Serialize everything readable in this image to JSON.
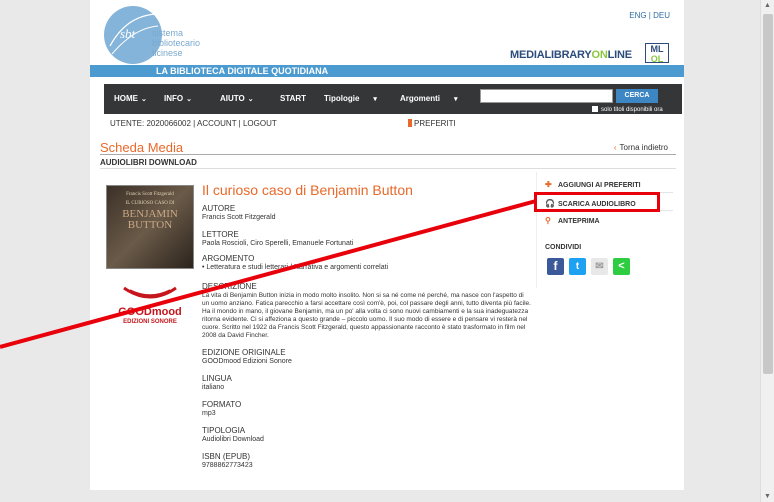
{
  "header": {
    "lang_links": "ENG | DEU",
    "logo_letters": "sbt",
    "logo_line1": "sistema",
    "logo_line2": "bibliotecario",
    "logo_line3": "ticinese",
    "mlol_part1": "MEDIALIBRARY",
    "mlol_part2": "ON",
    "mlol_part3": "LINE",
    "ml_badge_top": "ML",
    "ml_badge_bottom": "OL",
    "strip_title": "LA BIBLIOTECA DIGITALE QUOTIDIANA"
  },
  "nav": {
    "home": "HOME",
    "info": "INFO",
    "aiuto": "AIUTO",
    "start": "START",
    "tipologie": "Tipologie",
    "argomenti": "Argomenti",
    "search_placeholder": "",
    "search_button": "CERCA",
    "only_available": "solo titoli disponibili ora"
  },
  "userbar": {
    "text": "UTENTE: 2020066002 | ACCOUNT | LOGOUT",
    "preferiti": "PREFERITI"
  },
  "page": {
    "section_title": "Scheda Media",
    "back_link": "Torna indietro",
    "subsection": "AUDIOLIBRI DOWNLOAD"
  },
  "cover": {
    "author": "Francis Scott Fitzgerald",
    "title_small": "IL CURIOSO CASO DI",
    "title_big1": "BENJAMIN",
    "title_big2": "BUTTON"
  },
  "publisher": {
    "name": "GOODmood",
    "sub": "EDIZIONI SONORE"
  },
  "book": {
    "title": "Il curioso caso di Benjamin Button",
    "autore_label": "AUTORE",
    "autore": "Francis Scott Fitzgerald",
    "lettore_label": "LETTORE",
    "lettore": "Paola Roscioli, Ciro Sperelli, Emanuele Fortunati",
    "argomento_label": "ARGOMENTO",
    "argomento": "• Letteratura e studi letterari / Narrativa e argomenti correlati",
    "descrizione_label": "DESCRIZIONE",
    "descrizione": "La vita di Benjamin Button inizia in modo molto insolito. Non si sa né come né perché, ma nasce con l'aspetto di un uomo anziano. Fatica parecchio a farsi accettare così com'è, poi, col passare degli anni, tutto diventa più facile. Ha il mondo in mano, il giovane Benjamin, ma un po' alla volta ci sono nuovi cambiamenti e la sua inadeguatezza ritorna evidente. Ci si affeziona a questo grande – piccolo uomo. Il suo modo di essere e di pensare vi resterà nel cuore. Scritto nel 1922 da Francis Scott Fitzgerald, questo appassionante racconto è stato trasformato in film nel 2008 da David Fincher.",
    "edizione_label": "EDIZIONE ORIGINALE",
    "edizione": "GOODmood Edizioni Sonore",
    "lingua_label": "LINGUA",
    "lingua": "italiano",
    "formato_label": "FORMATO",
    "formato": "mp3",
    "tipologia_label": "TIPOLOGIA",
    "tipologia": "Audiolibri Download",
    "isbn_label": "ISBN (EPUB)",
    "isbn": "9788862773423"
  },
  "sidebar": {
    "aggiungi": "AGGIUNGI AI PREFERITI",
    "scarica": "SCARICA AUDIOLIBRO",
    "anteprima": "ANTEPRIMA",
    "condividi": "CONDIVIDI"
  },
  "colors": {
    "accent": "#e8692a",
    "nav_bg": "#353638",
    "strip": "#4b9bd1",
    "annotation": "#e8000b",
    "facebook": "#3b5998",
    "twitter": "#1da1f2",
    "share_green": "#2ecc40"
  }
}
